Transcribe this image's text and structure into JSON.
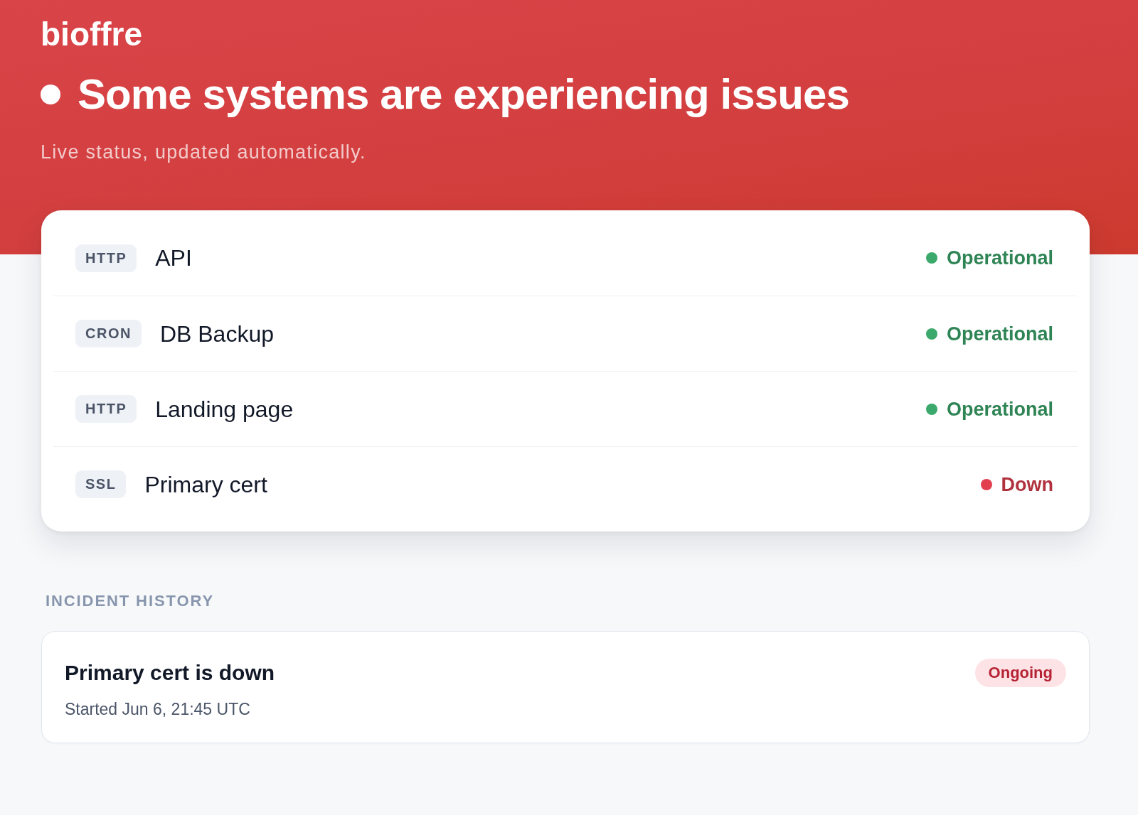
{
  "header": {
    "brand": "bioffre",
    "degraded": true,
    "headline": "Some systems are experiencing issues",
    "subtitle": "Live status, updated automatically."
  },
  "monitors": [
    {
      "type": "HTTP",
      "name": "API",
      "status": "Operational",
      "color": "#3ba96c"
    },
    {
      "type": "CRON",
      "name": "DB Backup",
      "status": "Operational",
      "color": "#3ba96c"
    },
    {
      "type": "HTTP",
      "name": "Landing page",
      "status": "Operational",
      "color": "#3ba96c"
    },
    {
      "type": "SSL",
      "name": "Primary cert",
      "status": "Down",
      "color": "#e2404f"
    }
  ],
  "incident_history": {
    "heading": "INCIDENT HISTORY",
    "incidents": [
      {
        "title": "Primary cert is down",
        "started": "Started Jun 6, 21:45 UTC",
        "badge": "Ongoing"
      }
    ]
  }
}
